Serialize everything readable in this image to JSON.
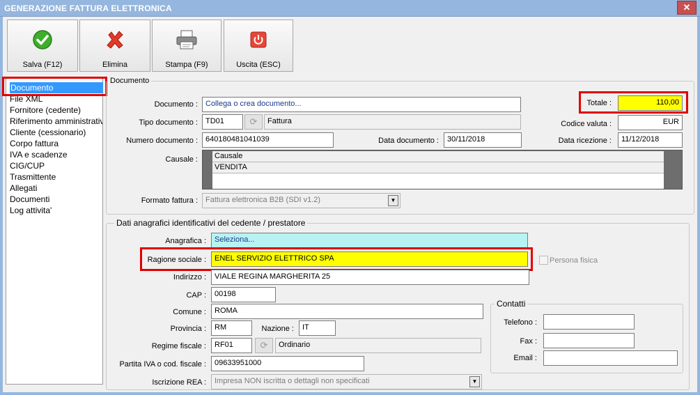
{
  "window": {
    "title": "GENERAZIONE FATTURA ELETTRONICA",
    "close_glyph": "✕"
  },
  "toolbar": {
    "save_label": "Salva (F12)",
    "delete_label": "Elimina",
    "print_label": "Stampa (F9)",
    "exit_label": "Uscita (ESC)"
  },
  "sidebar": {
    "items": [
      {
        "label": "Documento",
        "selected": true
      },
      {
        "label": "File XML"
      },
      {
        "label": "Fornitore (cedente)"
      },
      {
        "label": "Riferimento amministrativo"
      },
      {
        "label": "Cliente (cessionario)"
      },
      {
        "label": "Corpo fattura"
      },
      {
        "label": "IVA e scadenze"
      },
      {
        "label": "CIG/CUP"
      },
      {
        "label": "Trasmittente"
      },
      {
        "label": "Allegati"
      },
      {
        "label": "Documenti"
      },
      {
        "label": "Log attivita'"
      }
    ]
  },
  "documento": {
    "group_title": "Documento",
    "documento_label": "Documento :",
    "documento_value": "Collega o crea documento...",
    "totale_label": "Totale :",
    "totale_value": "110,00",
    "tipo_label": "Tipo documento :",
    "tipo_code": "TD01",
    "tipo_desc": "Fattura",
    "valuta_label": "Codice valuta :",
    "valuta_value": "EUR",
    "numero_label": "Numero documento :",
    "numero_value": "640180481041039",
    "data_doc_label": "Data documento :",
    "data_doc_value": "30/11/2018",
    "data_ric_label": "Data ricezione :",
    "data_ric_value": "11/12/2018",
    "causale_label": "Causale :",
    "causale_header": "Causale",
    "causale_rows": [
      "VENDITA"
    ],
    "formato_label": "Formato fattura :",
    "formato_value": "Fattura elettronica B2B (SDI v1.2)"
  },
  "cedente": {
    "group_title": "Dati anagrafici identificativi del cedente / prestatore",
    "anagrafica_label": "Anagrafica :",
    "anagrafica_value": "Seleziona...",
    "ragione_label": "Ragione sociale :",
    "ragione_value": "ENEL SERVIZIO ELETTRICO SPA",
    "persona_fisica_label": "Persona fisica",
    "indirizzo_label": "Indirizzo :",
    "indirizzo_value": "VIALE REGINA MARGHERITA 25",
    "cap_label": "CAP :",
    "cap_value": "00198",
    "comune_label": "Comune :",
    "comune_value": "ROMA",
    "provincia_label": "Provincia :",
    "provincia_value": "RM",
    "nazione_label": "Nazione :",
    "nazione_value": "IT",
    "regime_label": "Regime fiscale :",
    "regime_code": "RF01",
    "regime_desc": "Ordinario",
    "piva_label": "Partita IVA o cod. fiscale :",
    "piva_value": "09633951000",
    "rea_label": "Iscrizione REA :",
    "rea_value": "Impresa NON iscritta o dettagli non specificati"
  },
  "contatti": {
    "group_title": "Contatti",
    "telefono_label": "Telefono :",
    "fax_label": "Fax :",
    "email_label": "Email :"
  },
  "colors": {
    "highlight": "#ffff00",
    "annotation_red": "#e00000",
    "selection": "#3399ff"
  }
}
